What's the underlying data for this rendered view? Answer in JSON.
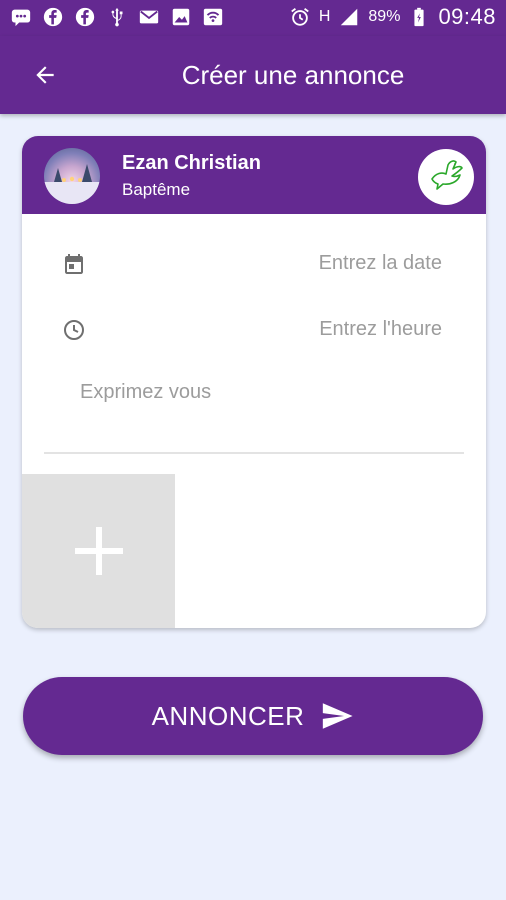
{
  "status_bar": {
    "left_icons": [
      "chat-icon",
      "facebook-icon",
      "facebook-icon",
      "usb-icon",
      "mail-icon",
      "image-icon",
      "wifi-calling-icon"
    ],
    "right_icons": [
      "alarm-icon",
      "hplus-icon",
      "signal-icon",
      "battery-icon"
    ],
    "network": "H",
    "battery_percent": "89%",
    "time": "09:48"
  },
  "app_bar": {
    "back_icon": "arrow-back-icon",
    "title": "Créer une annonce"
  },
  "card": {
    "header": {
      "name": "Ezan Christian",
      "event_type": "Baptême",
      "event_icon": "dove-icon"
    },
    "date_field": {
      "icon": "calendar-icon",
      "placeholder": "Entrez la date"
    },
    "time_field": {
      "icon": "clock-icon",
      "placeholder": "Entrez l'heure"
    },
    "message_field": {
      "placeholder": "Exprimez vous"
    },
    "add_photo": {
      "icon": "plus-icon"
    }
  },
  "submit": {
    "label": "ANNONCER",
    "icon": "send-icon"
  },
  "colors": {
    "primary": "#642991",
    "background": "#ebf0fd",
    "placeholder": "#9c9c9c",
    "photo_tile": "#e0e0e0",
    "dove": "#2ba82b"
  }
}
